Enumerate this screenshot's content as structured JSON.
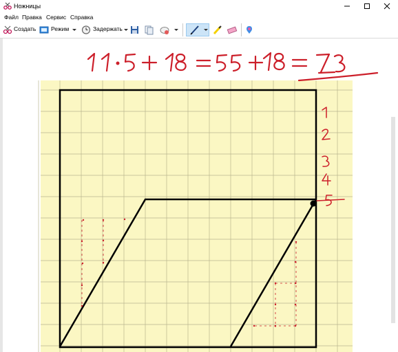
{
  "window": {
    "title": "Ножницы",
    "app_icon": "scissors-icon"
  },
  "menu": [
    "Файл",
    "Правка",
    "Сервис",
    "Справка"
  ],
  "toolbar": {
    "create_label": "Создать",
    "mode_label": "Режим",
    "delay_label": "Задержать",
    "icons": [
      "new-snip-icon",
      "mode-icon",
      "delay-clock-icon",
      "save-icon",
      "copy-icon",
      "send-icon",
      "pen-icon",
      "highlighter-icon",
      "eraser-icon",
      "paint3d-icon"
    ]
  },
  "handwriting": {
    "equation": [
      "11",
      "·",
      "5",
      "+",
      "18",
      "=",
      "55",
      "+",
      "18",
      "=",
      "73"
    ],
    "row_numbers": [
      "1",
      "2",
      "3",
      "4",
      "5"
    ],
    "ink_color": "#cc1f2a"
  },
  "colors": {
    "grid_background": "#fbf7c3",
    "grid_lines": "#b9b58f",
    "figure_lines": "#000000",
    "accent": "#0078d7"
  }
}
